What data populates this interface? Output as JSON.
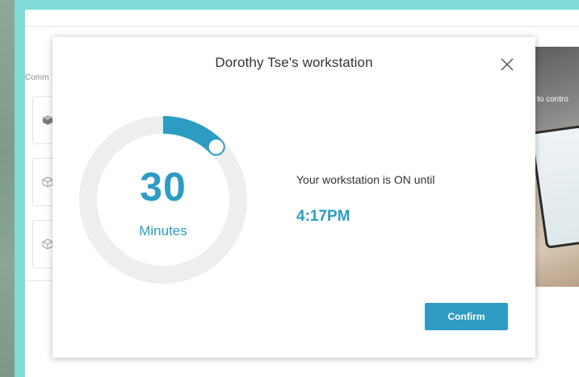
{
  "background": {
    "section_label": "Comm",
    "photo_caption": "to contro"
  },
  "modal": {
    "title": "Dorothy Tse's workstation",
    "close_icon": "close-icon"
  },
  "timer": {
    "value": "30",
    "unit": "Minutes",
    "progress_fraction": 0.125,
    "colors": {
      "accent": "#2d9cc3",
      "track": "#eeeeee"
    }
  },
  "status": {
    "text": "Your workstation is ON until",
    "time": "4:17PM"
  },
  "actions": {
    "confirm_label": "Confirm"
  }
}
